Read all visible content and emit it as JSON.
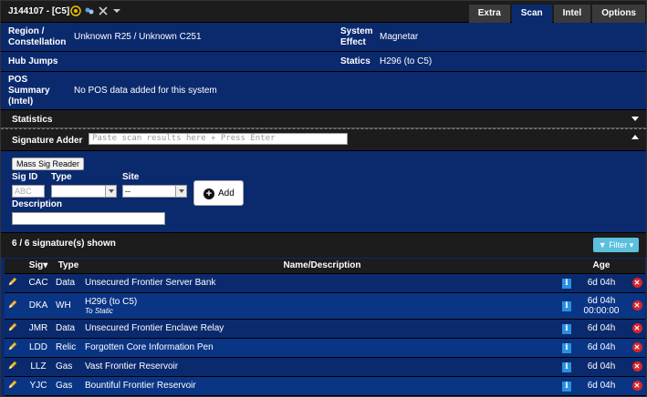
{
  "header": {
    "system_title": "J144107 - [C5]",
    "tabs": [
      {
        "label": "Extra",
        "active": false
      },
      {
        "label": "Scan",
        "active": true
      },
      {
        "label": "Intel",
        "active": false
      },
      {
        "label": "Options",
        "active": false
      }
    ]
  },
  "info": {
    "region_label": "Region / Constellation",
    "region_value": "Unknown R25 / Unknown C251",
    "effect_label": "System Effect",
    "effect_value": "Magnetar",
    "hub_label": "Hub Jumps",
    "statics_label": "Statics",
    "statics_value": "H296 (to C5)",
    "pos_label": "POS Summary (Intel)",
    "pos_value": "No POS data added for this system"
  },
  "statistics": {
    "label": "Statistics"
  },
  "adder": {
    "label": "Signature Adder",
    "paste_placeholder": "Paste scan results here + Press Enter",
    "mass_button": "Mass Sig Reader",
    "sigid_label": "Sig ID",
    "sigid_placeholder": "ABC",
    "type_label": "Type",
    "site_label": "Site",
    "site_value": "--",
    "description_label": "Description",
    "add_button": "Add"
  },
  "list": {
    "shown_text": "6 / 6 signature(s) shown",
    "filter_button": "Filter",
    "columns": {
      "sig": "Sig",
      "type": "Type",
      "desc": "Name/Description",
      "age": "Age"
    },
    "rows": [
      {
        "sig": "CAC",
        "type": "Data",
        "desc": "Unsecured Frontier Server Bank",
        "sub": "",
        "age": "6d 04h",
        "age2": ""
      },
      {
        "sig": "DKA",
        "type": "WH",
        "desc": "H296 (to C5)",
        "sub": "To Static",
        "age": "6d 04h",
        "age2": "00:00:00"
      },
      {
        "sig": "JMR",
        "type": "Data",
        "desc": "Unsecured Frontier Enclave Relay",
        "sub": "",
        "age": "6d 04h",
        "age2": ""
      },
      {
        "sig": "LDD",
        "type": "Relic",
        "desc": "Forgotten Core Information Pen",
        "sub": "",
        "age": "6d 04h",
        "age2": ""
      },
      {
        "sig": "LLZ",
        "type": "Gas",
        "desc": "Vast Frontier Reservoir",
        "sub": "",
        "age": "6d 04h",
        "age2": ""
      },
      {
        "sig": "YJC",
        "type": "Gas",
        "desc": "Bountiful Frontier Reservoir",
        "sub": "",
        "age": "6d 04h",
        "age2": ""
      }
    ]
  },
  "colors": {
    "panel_blue": "#0b2a6e",
    "row_alt_blue": "#0a3585",
    "dark_bar": "#1c1c1c",
    "filter_blue": "#5bc0de",
    "delete_red": "#d9242a",
    "info_blue": "#2a8fe0"
  }
}
